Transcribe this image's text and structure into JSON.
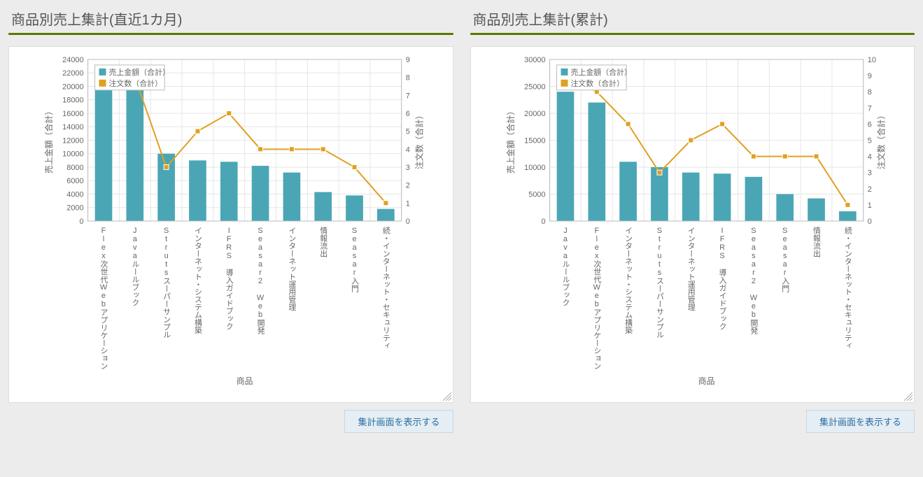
{
  "panels": [
    {
      "title": "商品別売上集計(直近1カ月)",
      "button_label": "集計画面を表示する",
      "chart": {
        "x_axis_title": "商品",
        "y_left_title": "売上金額（合計）",
        "y_right_title": "注文数（合計）",
        "legend": {
          "bar": "売上金額（合計）",
          "line": "注文数（合計）"
        }
      }
    },
    {
      "title": "商品別売上集計(累計)",
      "button_label": "集計画面を表示する",
      "chart": {
        "x_axis_title": "商品",
        "y_left_title": "売上金額（合計）",
        "y_right_title": "注文数（合計）",
        "legend": {
          "bar": "売上金額（合計）",
          "line": "注文数（合計）"
        }
      }
    }
  ],
  "chart_data": [
    {
      "type": "bar+line",
      "categories": [
        "Flex次世代Webアプリケーション",
        "Javaルールブック",
        "Strutsスーパーサンプル",
        "インターネット・システム構築",
        "IFRS 導入ガイドブック",
        "Seasar2 Web開発",
        "インターネット運用管理",
        "情報流出",
        "Seasar入門",
        "続・インターネット・セキュリティ"
      ],
      "series": [
        {
          "name": "売上金額（合計）",
          "axis": "left",
          "kind": "bar",
          "values": [
            22000,
            21500,
            10000,
            9000,
            8800,
            8200,
            7200,
            4300,
            3800,
            1800
          ]
        },
        {
          "name": "注文数（合計）",
          "axis": "right",
          "kind": "line",
          "values": [
            8,
            8,
            3,
            5,
            6,
            4,
            4,
            4,
            3,
            1
          ]
        }
      ],
      "y_left": {
        "min": 0,
        "max": 24000,
        "step": 2000
      },
      "y_right": {
        "min": 0,
        "max": 9,
        "step": 1
      },
      "xlabel": "商品",
      "ylabel_left": "売上金額（合計）",
      "ylabel_right": "注文数（合計）"
    },
    {
      "type": "bar+line",
      "categories": [
        "Javaルールブック",
        "Flex次世代Webアプリケーション",
        "インターネット・システム構築",
        "Strutsスーパーサンプル",
        "インターネット運用管理",
        "IFRS 導入ガイドブック",
        "Seasar2 Web開発",
        "Seasar入門",
        "情報流出",
        "続・インターネット・セキュリティ"
      ],
      "series": [
        {
          "name": "売上金額（合計）",
          "axis": "left",
          "kind": "bar",
          "values": [
            24000,
            22000,
            11000,
            10000,
            9000,
            8800,
            8200,
            5000,
            4200,
            1800
          ]
        },
        {
          "name": "注文数（合計）",
          "axis": "right",
          "kind": "line",
          "values": [
            9,
            8,
            6,
            3,
            5,
            6,
            4,
            4,
            4,
            1
          ]
        }
      ],
      "y_left": {
        "min": 0,
        "max": 30000,
        "step": 5000
      },
      "y_right": {
        "min": 0,
        "max": 10,
        "step": 1
      },
      "xlabel": "商品",
      "ylabel_left": "売上金額（合計）",
      "ylabel_right": "注文数（合計）"
    }
  ]
}
